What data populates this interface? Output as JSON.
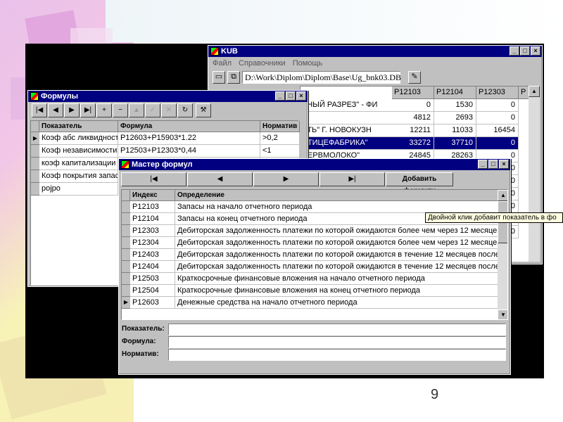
{
  "slide": {
    "number": "9"
  },
  "kub": {
    "title": "KUB",
    "menu": [
      "Файл",
      "Справочники",
      "Помощь"
    ],
    "path": "D:\\Work\\Diplom\\Diplom\\Base\\Ug_bnk03.DB",
    "columns": [
      "P12103",
      "P12104",
      "P12303",
      "P"
    ],
    "rows": [
      {
        "name": "ЬНЫЙ РАЗРЕЗ\" - ФИ",
        "values": [
          "0",
          "1530",
          "0"
        ]
      },
      {
        "name": "7",
        "values": [
          "4812",
          "2693",
          "0"
        ]
      },
      {
        "name": "ЕТЬ\" Г. НОВОКУЗН",
        "values": [
          "12211",
          "11033",
          "16454"
        ]
      },
      {
        "name": "ПТИЦЕФАБРИКА\"",
        "values": [
          "33272",
          "37710",
          "0"
        ],
        "selected": true
      },
      {
        "name": "СЕРВМОЛОКО\"",
        "values": [
          "24845",
          "28263",
          "0"
        ]
      },
      {
        "name": "",
        "values": [
          "",
          "",
          "0"
        ]
      },
      {
        "name": "",
        "values": [
          "",
          "",
          "0"
        ]
      },
      {
        "name": "",
        "values": [
          "",
          "",
          "0"
        ]
      },
      {
        "name": "",
        "values": [
          "",
          "",
          "0"
        ]
      },
      {
        "name": "",
        "values": [
          "",
          "",
          "96"
        ]
      },
      {
        "name": "",
        "values": [
          "",
          "",
          "0"
        ]
      }
    ]
  },
  "formuly": {
    "title": "Формулы",
    "columns": [
      "Показатель",
      "Формула",
      "Норматив"
    ],
    "rows": [
      {
        "name": "Коэф абс ликвидност",
        "formula": "P12603+P15903*1.22",
        "norm": ">0,2",
        "current": true
      },
      {
        "name": "Коэф независимости",
        "formula": "P12503+P12303*0,44",
        "norm": "<1"
      },
      {
        "name": "коэф капитализации",
        "formula": "",
        "norm": ""
      },
      {
        "name": "Коэф покрытия запас",
        "formula": "",
        "norm": ""
      },
      {
        "name": "pojpo",
        "formula": "",
        "norm": ""
      }
    ]
  },
  "master": {
    "title": "Мастер формул",
    "add_button": "Добавить формулу",
    "columns": [
      "Индекс",
      "Определение"
    ],
    "rows": [
      {
        "index": "P12103",
        "def": "Запасы  на начало отчетного периода"
      },
      {
        "index": "P12104",
        "def": "Запасы  на конец отчетного периода"
      },
      {
        "index": "P12303",
        "def": "Дебиторская задолженность платежи по которой ожидаются более чем через 12 месяце"
      },
      {
        "index": "P12304",
        "def": "Дебиторская задолженность платежи по которой ожидаются более чем через 12 месяце"
      },
      {
        "index": "P12403",
        "def": "Дебиторская задолженность платежи по которой ожидаются в течение 12 месяцев после"
      },
      {
        "index": "P12404",
        "def": "Дебиторская задолженность платежи по которой ожидаются в течение 12 месяцев после"
      },
      {
        "index": "P12503",
        "def": "Краткосрочные финансовые вложения  на начало отчетного периода"
      },
      {
        "index": "P12504",
        "def": "Краткосрочные финансовые вложения  на конец отчетного периода"
      },
      {
        "index": "P12603",
        "def": "Денежные средства  на начало отчетного периода",
        "current": true
      }
    ],
    "fields": [
      {
        "label": "Показатель:"
      },
      {
        "label": "Формула:"
      },
      {
        "label": "Норматив:"
      }
    ],
    "tooltip": "Двойной клик добавит показатель в фо"
  }
}
